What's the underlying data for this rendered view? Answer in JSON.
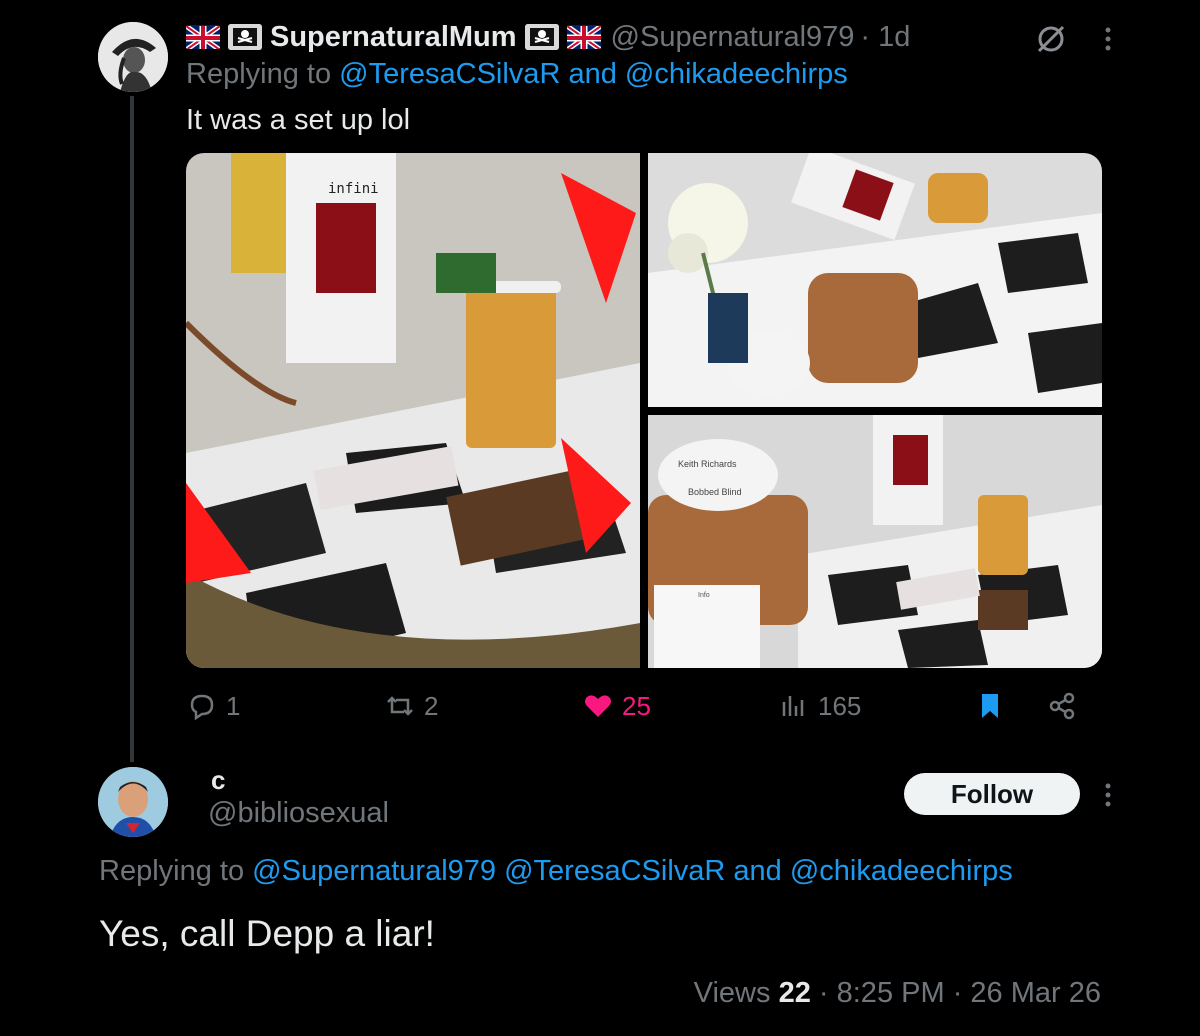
{
  "tweet1": {
    "display_name": "SupernaturalMum",
    "handle": "@Supernatural979",
    "separator": "·",
    "time": "1d",
    "replying_prefix": "Replying to",
    "reply_to_1": "@TeresaCSilvaR",
    "and": "and",
    "reply_to_2": "@chikadeechirps",
    "text": "It was a set up lol",
    "media_text": {
      "mug_label": "infini",
      "disc_label_1": "Keith Richards",
      "disc_label_2": "Bobbed Blind",
      "info_title": "Info"
    },
    "actions": {
      "replies": "1",
      "reposts": "2",
      "likes": "25",
      "views": "165"
    }
  },
  "tweet2": {
    "display_name": "c",
    "handle": "@bibliosexual",
    "follow_label": "Follow",
    "replying_prefix": "Replying to",
    "reply_to_1": "@Supernatural979",
    "reply_to_2": "@TeresaCSilvaR",
    "and": "and",
    "reply_to_3": "@chikadeechirps",
    "text": "Yes, call Depp a liar!",
    "views_label": "Views",
    "views_count": "22",
    "time": "8:25 PM",
    "date": "26 Mar 26",
    "separator": "·"
  },
  "icons": [
    "uk-flag-icon",
    "pirate-flag-icon",
    "grok-icon",
    "more-icon",
    "reply-icon",
    "repost-icon",
    "like-icon",
    "views-icon",
    "bookmark-icon",
    "share-icon"
  ],
  "colors": {
    "link": "#1d9bf0",
    "like": "#f91880",
    "muted": "#71767b",
    "text": "#e7e9ea",
    "bookmark": "#1d9bf0"
  }
}
